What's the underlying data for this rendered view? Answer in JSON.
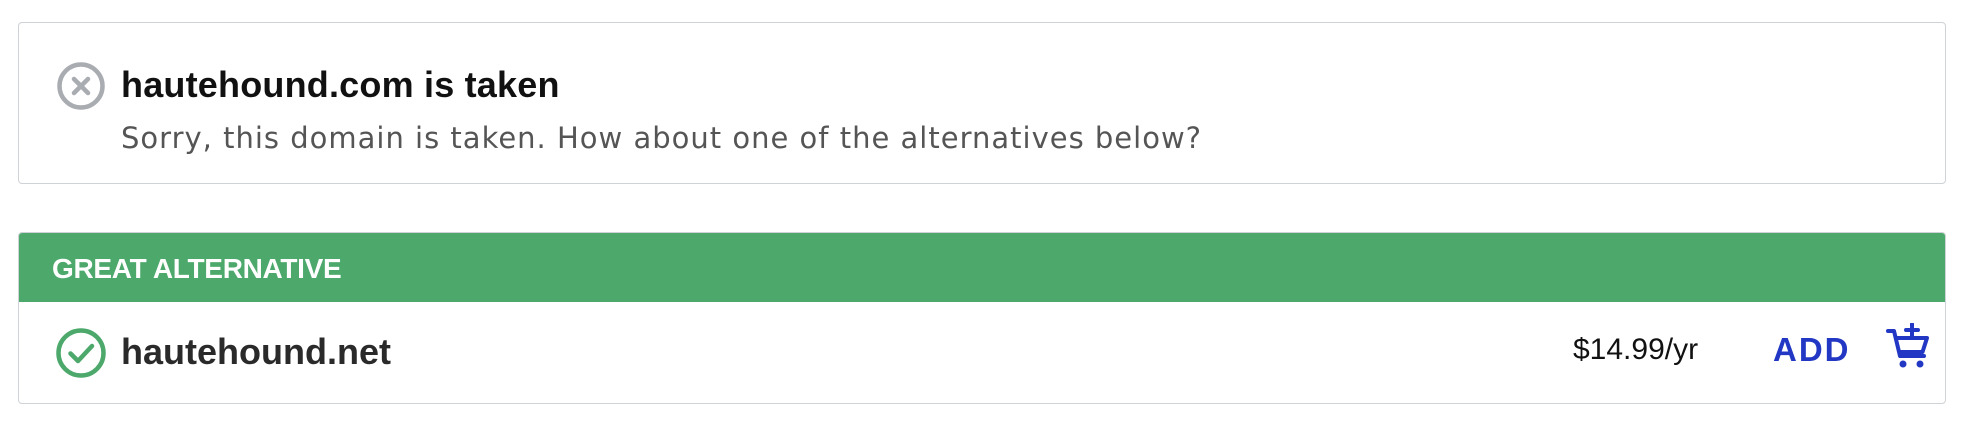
{
  "taken": {
    "title": "hautehound.com is taken",
    "message": "Sorry, this domain is taken. How about one of the alternatives below?",
    "icon": "x-circle-icon"
  },
  "alternative": {
    "banner_label": "GREAT ALTERNATIVE",
    "domain": "hautehound.net",
    "price": "$14.99/yr",
    "add_label": "ADD",
    "icons": {
      "status": "check-circle-icon",
      "cart": "cart-plus-icon"
    }
  },
  "colors": {
    "accent_green": "#4ca86b",
    "link_blue": "#2238c4",
    "muted_gray": "#a9acb0"
  }
}
